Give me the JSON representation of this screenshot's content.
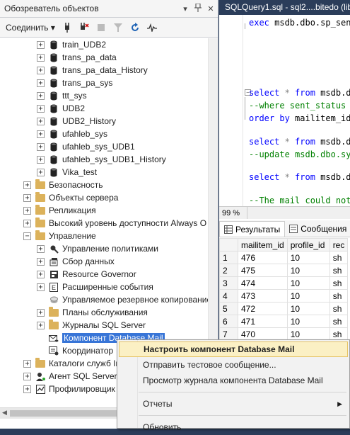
{
  "object_explorer": {
    "title": "Обозреватель объектов",
    "title_buttons": [
      "▾",
      "📌",
      "✕"
    ],
    "connect_label": "Соединить ▾",
    "toolbar_icons": [
      "connect-plug-icon",
      "disconnect-icon",
      "stop-icon",
      "filter-icon",
      "refresh-icon",
      "activity-icon"
    ],
    "tree": [
      {
        "label": "train_UDB2",
        "type": "db",
        "expander": "+",
        "indent": 1
      },
      {
        "label": "trans_pa_data",
        "type": "db",
        "expander": "+",
        "indent": 1
      },
      {
        "label": "trans_pa_data_History",
        "type": "db",
        "expander": "+",
        "indent": 1
      },
      {
        "label": "trans_pa_sys",
        "type": "db",
        "expander": "+",
        "indent": 1
      },
      {
        "label": "ttt_sys",
        "type": "db",
        "expander": "+",
        "indent": 1
      },
      {
        "label": "UDB2",
        "type": "db",
        "expander": "+",
        "indent": 1
      },
      {
        "label": "UDB2_History",
        "type": "db",
        "expander": "+",
        "indent": 1
      },
      {
        "label": "ufahleb_sys",
        "type": "db",
        "expander": "+",
        "indent": 1
      },
      {
        "label": "ufahleb_sys_UDB1",
        "type": "db",
        "expander": "+",
        "indent": 1
      },
      {
        "label": "ufahleb_sys_UDB1_History",
        "type": "db",
        "expander": "+",
        "indent": 1
      },
      {
        "label": "Vika_test",
        "type": "db",
        "expander": "+",
        "indent": 1
      },
      {
        "label": "Безопасность",
        "type": "folder",
        "expander": "+",
        "indent": 0
      },
      {
        "label": "Объекты сервера",
        "type": "folder",
        "expander": "+",
        "indent": 0
      },
      {
        "label": "Репликация",
        "type": "folder",
        "expander": "+",
        "indent": 0
      },
      {
        "label": "Высокий уровень доступности Always O",
        "type": "folder",
        "expander": "+",
        "indent": 0
      },
      {
        "label": "Управление",
        "type": "folder",
        "expander": "−",
        "indent": 0
      },
      {
        "label": "Управление политиками",
        "type": "policy",
        "expander": "+",
        "indent": 1
      },
      {
        "label": "Сбор данных",
        "type": "datacollect",
        "expander": "+",
        "indent": 1
      },
      {
        "label": "Resource Governor",
        "type": "governor",
        "expander": "+",
        "indent": 1
      },
      {
        "label": "Расширенные события",
        "type": "events",
        "expander": "+",
        "indent": 1
      },
      {
        "label": "Управляемое резервное копирование",
        "type": "backup",
        "expander": "",
        "indent": 1
      },
      {
        "label": "Планы обслуживания",
        "type": "folder",
        "expander": "+",
        "indent": 1
      },
      {
        "label": "Журналы SQL Server",
        "type": "folder",
        "expander": "+",
        "indent": 1
      },
      {
        "label": "Компонент Database Mail",
        "type": "mail",
        "expander": "",
        "indent": 1,
        "selected": true
      },
      {
        "label": "Координатор",
        "type": "coordinator",
        "expander": "",
        "indent": 1
      },
      {
        "label": "Каталоги служб In",
        "type": "folder",
        "expander": "+",
        "indent": 0
      },
      {
        "label": "Агент SQL Server",
        "type": "agent",
        "expander": "+",
        "indent": 0
      },
      {
        "label": "Профилировщик",
        "type": "profiler",
        "expander": "+",
        "indent": 0
      }
    ]
  },
  "editor": {
    "tab_title": "SQLQuery1.sql - sql2....bitedo (lib",
    "code_lines": [
      {
        "parts": [
          {
            "t": "exec msdb.dbo.sp_sen",
            "c": "kw-mix"
          }
        ]
      },
      {
        "parts": [
          {
            "t": "select",
            "c": "kw"
          },
          {
            "t": " * ",
            "c": "gr"
          },
          {
            "t": "from",
            "c": "kw"
          },
          {
            "t": " msdb.d",
            "c": ""
          }
        ]
      },
      {
        "parts": [
          {
            "t": "--where sent_status",
            "c": "cm"
          }
        ]
      },
      {
        "parts": [
          {
            "t": "order by",
            "c": "kw"
          },
          {
            "t": " mailitem_id",
            "c": ""
          }
        ]
      },
      {
        "parts": [
          {
            "t": "select",
            "c": "kw"
          },
          {
            "t": " * ",
            "c": "gr"
          },
          {
            "t": "from",
            "c": "kw"
          },
          {
            "t": " msdb.d",
            "c": ""
          }
        ]
      },
      {
        "parts": [
          {
            "t": "--update msdb.dbo.sy",
            "c": "cm"
          }
        ]
      },
      {
        "parts": [
          {
            "t": "select",
            "c": "kw"
          },
          {
            "t": " * ",
            "c": "gr"
          },
          {
            "t": "from",
            "c": "kw"
          },
          {
            "t": " msdb.d",
            "c": ""
          }
        ]
      },
      {
        "parts": [
          {
            "t": "--The mail could not",
            "c": "cm"
          }
        ]
      }
    ],
    "zoom": "99 %",
    "results_tabs": [
      "Результаты",
      "Сообщения"
    ],
    "grid_columns": [
      "",
      "mailitem_id",
      "profile_id",
      "rec"
    ],
    "grid_rows": [
      [
        "1",
        "476",
        "10",
        "sh"
      ],
      [
        "2",
        "475",
        "10",
        "sh"
      ],
      [
        "3",
        "474",
        "10",
        "sh"
      ],
      [
        "4",
        "473",
        "10",
        "sh"
      ],
      [
        "5",
        "472",
        "10",
        "sh"
      ],
      [
        "6",
        "471",
        "10",
        "sh"
      ],
      [
        "7",
        "470",
        "10",
        "sh"
      ]
    ]
  },
  "context_menu": {
    "items": [
      {
        "label": "Настроить компонент Database Mail",
        "highlighted": true
      },
      {
        "label": "Отправить тестовое сообщение..."
      },
      {
        "label": "Просмотр журнала компонента Database Mail"
      },
      {
        "separator": true
      },
      {
        "label": "Отчеты",
        "submenu": true
      },
      {
        "separator": true
      },
      {
        "label": "Обновить"
      }
    ]
  }
}
